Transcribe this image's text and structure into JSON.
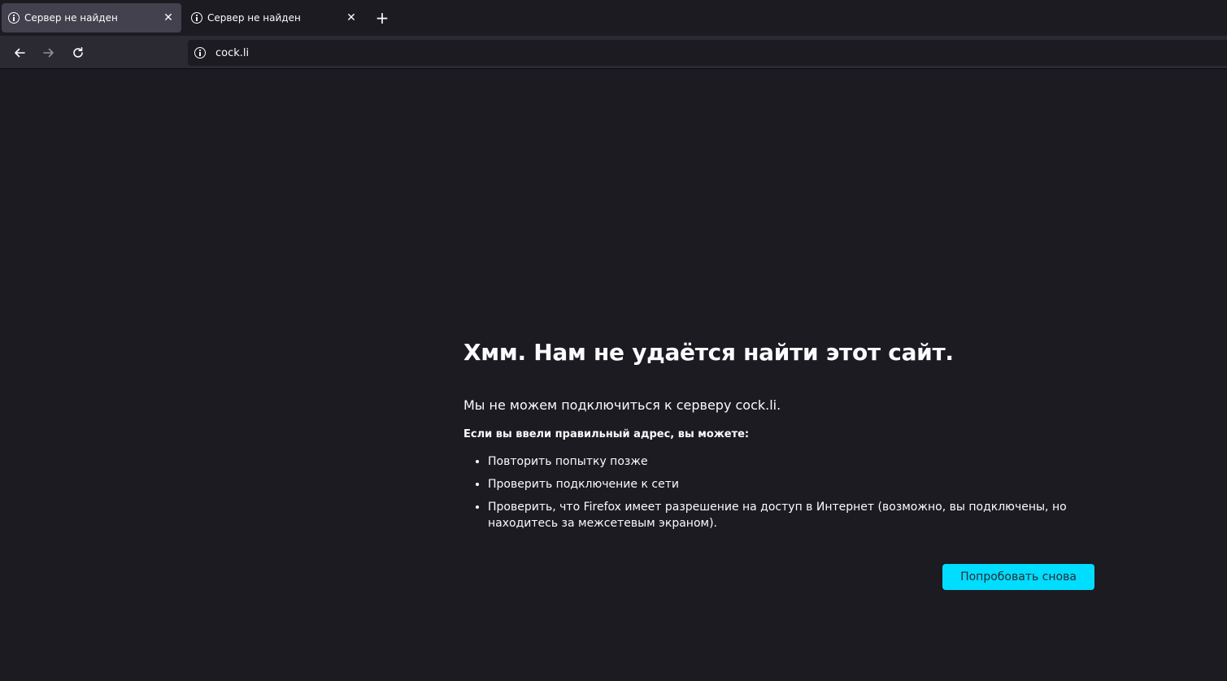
{
  "tabs": [
    {
      "title": "Сервер не найден",
      "icon": "info-icon",
      "close": "✕",
      "active": true
    },
    {
      "title": "Сервер не найден",
      "icon": "info-icon",
      "close": "✕",
      "active": false
    }
  ],
  "new_tab_label": "+",
  "nav": {
    "back_icon": "arrow-left-icon",
    "forward_icon": "arrow-right-icon",
    "reload_icon": "reload-icon"
  },
  "urlbar": {
    "value": "cock.li",
    "icon": "info-icon"
  },
  "error": {
    "title": "Хмм. Нам не удаётся найти этот сайт.",
    "description": "Мы не можем подключиться к серверу cock.li.",
    "subheading": "Если вы ввели правильный адрес, вы можете:",
    "suggestions": [
      "Повторить попытку позже",
      "Проверить подключение к сети",
      "Проверить, что Firefox имеет разрешение на доступ в Интернет (возможно, вы подключены, но находитесь за межсетевым экраном)."
    ],
    "retry_label": "Попробовать снова"
  },
  "colors": {
    "background": "#1c1b22",
    "toolbar": "#2b2a33",
    "accent": "#00ddff",
    "text": "#fbfbfe"
  }
}
